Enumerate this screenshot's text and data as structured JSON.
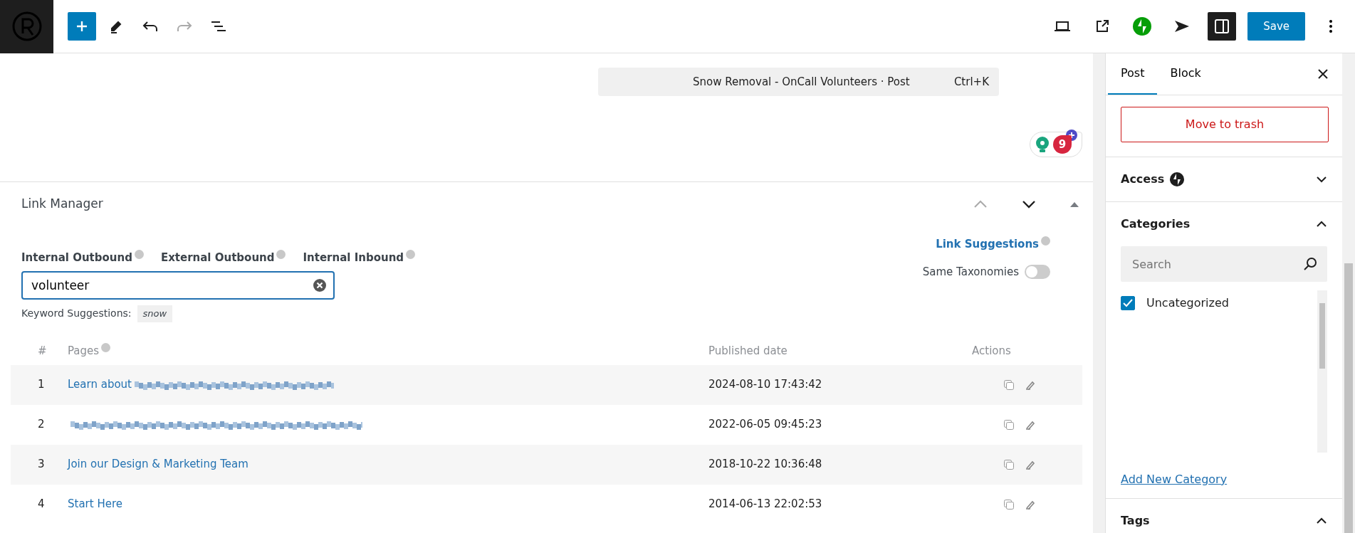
{
  "toolbar": {
    "save": "Save"
  },
  "command_bar": {
    "title": "Snow Removal - OnCall Volunteers · Post",
    "shortcut": "Ctrl+K"
  },
  "notification_badge": "9",
  "link_manager": {
    "title": "Link Manager",
    "tabs": [
      {
        "label": "Internal Outbound",
        "selected": false
      },
      {
        "label": "External Outbound",
        "selected": false
      },
      {
        "label": "Internal Inbound",
        "selected": false
      }
    ],
    "link_suggestions": "Link Suggestions",
    "same_taxonomies": {
      "label": "Same Taxonomies",
      "on": false
    },
    "search": {
      "value": "volunteer"
    },
    "keyword_label": "Keyword Suggestions:",
    "keywords": [
      "snow"
    ],
    "table": {
      "columns": [
        "#",
        "Pages",
        "Published date",
        "Actions"
      ],
      "rows": [
        {
          "num": "1",
          "title": "Learn about",
          "redacted": true,
          "date": "2024-08-10 17:43:42"
        },
        {
          "num": "2",
          "title": "",
          "redacted": true,
          "date": "2022-06-05 09:45:23"
        },
        {
          "num": "3",
          "title": "Join our Design & Marketing Team",
          "redacted": false,
          "date": "2018-10-22 10:36:48"
        },
        {
          "num": "4",
          "title": "Start Here",
          "redacted": false,
          "date": "2014-06-13 22:02:53"
        }
      ]
    }
  },
  "sidebar": {
    "tabs": [
      {
        "label": "Post",
        "selected": true
      },
      {
        "label": "Block",
        "selected": false
      }
    ],
    "trash": "Move to trash",
    "panels": [
      {
        "title": "Access",
        "expanded": false,
        "kind": "access"
      },
      {
        "title": "Categories",
        "expanded": true,
        "kind": "categories"
      },
      {
        "title": "Tags",
        "expanded": true,
        "kind": "tags"
      }
    ],
    "categories": {
      "search_placeholder": "Search",
      "items": [
        {
          "label": "Uncategorized",
          "checked": true
        }
      ],
      "add_new": "Add New Category"
    }
  }
}
